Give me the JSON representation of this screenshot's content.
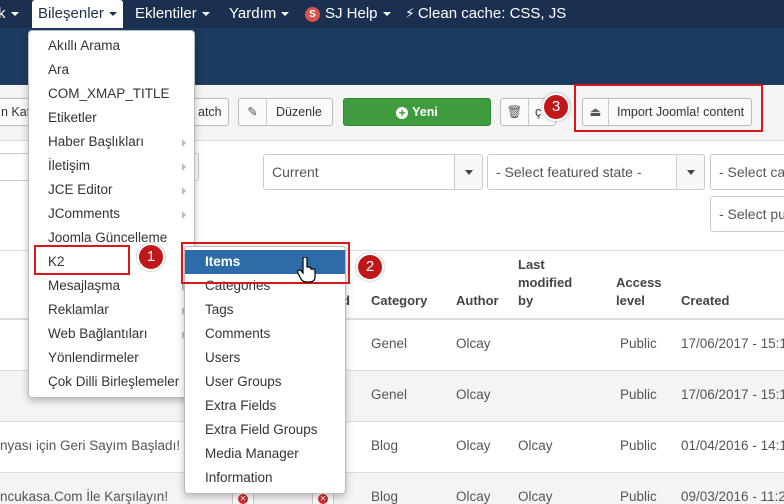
{
  "topnav": {
    "partial_left": "k",
    "items": [
      {
        "label": "Bileşenler"
      },
      {
        "label": "Eklentiler"
      },
      {
        "label": "Yardım"
      },
      {
        "label": "SJ Help"
      },
      {
        "label": "Clean cache: CSS, JS"
      }
    ],
    "sj_badge": "S"
  },
  "toolbar": {
    "partial_left": "n Kat",
    "partial_batch": "atch",
    "edit_label": "Düzenle",
    "new_label": "Yeni",
    "partial_trash": "ç",
    "import_label": "Import Joomla! content"
  },
  "filters": {
    "state": "Current",
    "featured": "- Select featured state -",
    "category": "- Select cat",
    "publish": "- Select pub"
  },
  "table": {
    "headers": {
      "featured_partial": "d",
      "category": "Category",
      "author": "Author",
      "last_modified": [
        "Last",
        "modified",
        "by"
      ],
      "access": [
        "Access",
        "level"
      ],
      "created": "Created"
    },
    "rows": [
      {
        "title": "",
        "category": "Genel",
        "author": "Olcay",
        "modified_by": "",
        "access": "Public",
        "created": "17/06/2017 - 15:1"
      },
      {
        "title": "",
        "category": "Genel",
        "author": "Olcay",
        "modified_by": "",
        "access": "Public",
        "created": "17/06/2017 - 15:1"
      },
      {
        "title": "nyası için Geri Sayım Başladı!",
        "category": "Blog",
        "author": "Olcay",
        "modified_by": "Olcay",
        "access": "Public",
        "created": "01/04/2016 - 14:1"
      },
      {
        "title": "ncukasa.Com İle Karşılayın!",
        "category": "Blog",
        "author": "Olcay",
        "modified_by": "Olcay",
        "access": "Public",
        "created": "09/03/2016 - 11:2"
      }
    ]
  },
  "components_menu": [
    {
      "label": "Akıllı Arama",
      "sub": false
    },
    {
      "label": "Ara",
      "sub": false
    },
    {
      "label": "COM_XMAP_TITLE",
      "sub": false
    },
    {
      "label": "Etiketler",
      "sub": false
    },
    {
      "label": "Haber Başlıkları",
      "sub": true
    },
    {
      "label": "İletişim",
      "sub": true
    },
    {
      "label": "JCE Editor",
      "sub": true
    },
    {
      "label": "JComments",
      "sub": true
    },
    {
      "label": "Joomla Güncelleme",
      "sub": false
    },
    {
      "label": "K2",
      "sub": false
    },
    {
      "label": "Mesajlaşma",
      "sub": true
    },
    {
      "label": "Reklamlar",
      "sub": true
    },
    {
      "label": "Web Bağlantıları",
      "sub": true
    },
    {
      "label": "Yönlendirmeler",
      "sub": false
    },
    {
      "label": "Çok Dilli Birleşlemeler",
      "sub": false
    }
  ],
  "k2_menu": [
    {
      "label": "Items"
    },
    {
      "label": "Categories"
    },
    {
      "label": "Tags"
    },
    {
      "label": "Comments"
    },
    {
      "label": "Users"
    },
    {
      "label": "User Groups"
    },
    {
      "label": "Extra Fields"
    },
    {
      "label": "Extra Field Groups"
    },
    {
      "label": "Media Manager"
    },
    {
      "label": "Information"
    }
  ],
  "annotations": [
    "1",
    "2",
    "3"
  ],
  "colors": {
    "navbar": "#1b3050",
    "header": "#1d3b60",
    "highlight": "#2d6ca8",
    "green": "#3e9c3e",
    "annotation_red": "#c0171b"
  }
}
